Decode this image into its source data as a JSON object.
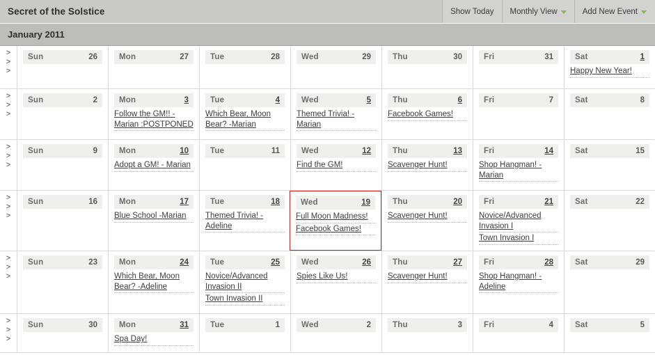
{
  "titlebar": {
    "title": "Secret of the Solstice",
    "buttons": [
      {
        "label": "Show Today",
        "has_caret": false
      },
      {
        "label": "Monthly View",
        "has_caret": true
      },
      {
        "label": "Add New Event",
        "has_caret": true
      }
    ]
  },
  "monthbar": {
    "label": "January 2011"
  },
  "gutter": {
    "chevron": ">",
    "count": 3
  },
  "colors": {
    "titlebar_bg": "#c9c9c7",
    "monthbar_bg": "#bdbdbb",
    "day_header_bg": "#efefed",
    "grid_line": "#d9d9d9",
    "today_border": "#cc2222",
    "caret_green": "#8db84b",
    "link_text": "#3d3d3d"
  },
  "weeks": [
    {
      "days": [
        {
          "dow": "Sun",
          "num": "26",
          "num_link": false,
          "today": false,
          "events": []
        },
        {
          "dow": "Mon",
          "num": "27",
          "num_link": false,
          "today": false,
          "events": []
        },
        {
          "dow": "Tue",
          "num": "28",
          "num_link": false,
          "today": false,
          "events": []
        },
        {
          "dow": "Wed",
          "num": "29",
          "num_link": false,
          "today": false,
          "events": []
        },
        {
          "dow": "Thu",
          "num": "30",
          "num_link": false,
          "today": false,
          "events": []
        },
        {
          "dow": "Fri",
          "num": "31",
          "num_link": false,
          "today": false,
          "events": []
        },
        {
          "dow": "Sat",
          "num": "1",
          "num_link": true,
          "today": false,
          "events": [
            "Happy New Year!"
          ]
        }
      ]
    },
    {
      "days": [
        {
          "dow": "Sun",
          "num": "2",
          "num_link": false,
          "today": false,
          "events": []
        },
        {
          "dow": "Mon",
          "num": "3",
          "num_link": true,
          "today": false,
          "events": [
            "Follow the GM!! -Marian :POSTPONED"
          ]
        },
        {
          "dow": "Tue",
          "num": "4",
          "num_link": true,
          "today": false,
          "events": [
            "Which Bear, Moon Bear? -Marian"
          ]
        },
        {
          "dow": "Wed",
          "num": "5",
          "num_link": true,
          "today": false,
          "events": [
            "Themed Trivia! -Marian"
          ]
        },
        {
          "dow": "Thu",
          "num": "6",
          "num_link": true,
          "today": false,
          "events": [
            "Facebook Games!"
          ]
        },
        {
          "dow": "Fri",
          "num": "7",
          "num_link": false,
          "today": false,
          "events": []
        },
        {
          "dow": "Sat",
          "num": "8",
          "num_link": false,
          "today": false,
          "events": []
        }
      ]
    },
    {
      "days": [
        {
          "dow": "Sun",
          "num": "9",
          "num_link": false,
          "today": false,
          "events": []
        },
        {
          "dow": "Mon",
          "num": "10",
          "num_link": true,
          "today": false,
          "events": [
            "Adopt a GM! - Marian"
          ]
        },
        {
          "dow": "Tue",
          "num": "11",
          "num_link": false,
          "today": false,
          "events": []
        },
        {
          "dow": "Wed",
          "num": "12",
          "num_link": true,
          "today": false,
          "events": [
            "Find the GM!"
          ]
        },
        {
          "dow": "Thu",
          "num": "13",
          "num_link": true,
          "today": false,
          "events": [
            "Scavenger Hunt!"
          ]
        },
        {
          "dow": "Fri",
          "num": "14",
          "num_link": true,
          "today": false,
          "events": [
            "Shop Hangman! -Marian"
          ]
        },
        {
          "dow": "Sat",
          "num": "15",
          "num_link": false,
          "today": false,
          "events": []
        }
      ]
    },
    {
      "days": [
        {
          "dow": "Sun",
          "num": "16",
          "num_link": false,
          "today": false,
          "events": []
        },
        {
          "dow": "Mon",
          "num": "17",
          "num_link": true,
          "today": false,
          "events": [
            "Blue School -Marian"
          ]
        },
        {
          "dow": "Tue",
          "num": "18",
          "num_link": true,
          "today": false,
          "events": [
            "Themed Trivia! -Adeline"
          ]
        },
        {
          "dow": "Wed",
          "num": "19",
          "num_link": true,
          "today": true,
          "events": [
            "Full Moon Madness!",
            "Facebook Games!"
          ]
        },
        {
          "dow": "Thu",
          "num": "20",
          "num_link": true,
          "today": false,
          "events": [
            "Scavenger Hunt!"
          ]
        },
        {
          "dow": "Fri",
          "num": "21",
          "num_link": true,
          "today": false,
          "events": [
            "Novice/Advanced Invasion I",
            "Town Invasion I"
          ]
        },
        {
          "dow": "Sat",
          "num": "22",
          "num_link": false,
          "today": false,
          "events": []
        }
      ]
    },
    {
      "days": [
        {
          "dow": "Sun",
          "num": "23",
          "num_link": false,
          "today": false,
          "events": []
        },
        {
          "dow": "Mon",
          "num": "24",
          "num_link": true,
          "today": false,
          "events": [
            "Which Bear, Moon Bear? -Adeline"
          ]
        },
        {
          "dow": "Tue",
          "num": "25",
          "num_link": true,
          "today": false,
          "events": [
            "Novice/Advanced Invasion II",
            "Town Invasion II"
          ]
        },
        {
          "dow": "Wed",
          "num": "26",
          "num_link": true,
          "today": false,
          "events": [
            "Spies Like Us!"
          ]
        },
        {
          "dow": "Thu",
          "num": "27",
          "num_link": true,
          "today": false,
          "events": [
            "Scavenger Hunt!"
          ]
        },
        {
          "dow": "Fri",
          "num": "28",
          "num_link": true,
          "today": false,
          "events": [
            "Shop Hangman! -Adeline"
          ]
        },
        {
          "dow": "Sat",
          "num": "29",
          "num_link": false,
          "today": false,
          "events": []
        }
      ]
    },
    {
      "days": [
        {
          "dow": "Sun",
          "num": "30",
          "num_link": false,
          "today": false,
          "events": []
        },
        {
          "dow": "Mon",
          "num": "31",
          "num_link": true,
          "today": false,
          "events": [
            "Spa Day!"
          ]
        },
        {
          "dow": "Tue",
          "num": "1",
          "num_link": false,
          "today": false,
          "events": []
        },
        {
          "dow": "Wed",
          "num": "2",
          "num_link": false,
          "today": false,
          "events": []
        },
        {
          "dow": "Thu",
          "num": "3",
          "num_link": false,
          "today": false,
          "events": []
        },
        {
          "dow": "Fri",
          "num": "4",
          "num_link": false,
          "today": false,
          "events": []
        },
        {
          "dow": "Sat",
          "num": "5",
          "num_link": false,
          "today": false,
          "events": []
        }
      ]
    }
  ]
}
